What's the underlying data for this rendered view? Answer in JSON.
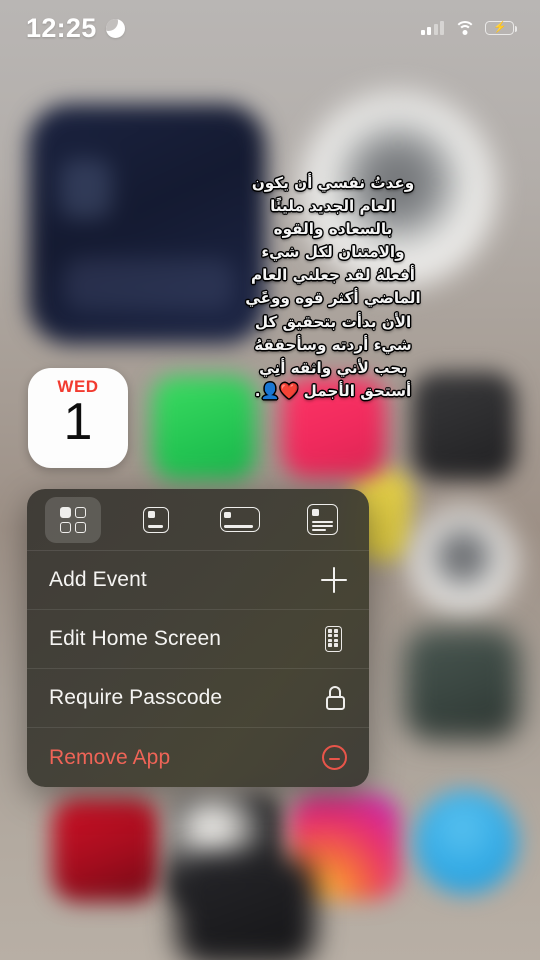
{
  "status_bar": {
    "time": "12:25",
    "dnd_icon": "moon-icon",
    "signal_icon": "cellular-signal-icon",
    "wifi_icon": "wifi-icon",
    "battery_icon": "battery-charging-icon"
  },
  "calendar_icon": {
    "weekday": "WED",
    "day": "1"
  },
  "overlay_text": {
    "lines": [
      "وعدتُ نفسي أن يكون",
      "العام الجديد مليئًا",
      "بالسعاده والقوه",
      "والامتنان لكل شيء",
      "أفعلهُ لقد جعلني العام",
      "الماضي أكثر قوه ووعًي",
      "الأن بدأت بتحقيق كل",
      "شيء أردته وسأحققهُ",
      "بحب لأني واثقه أنِي",
      "أستحق الأجمل ❤️👤."
    ]
  },
  "context_menu": {
    "size_options": [
      {
        "name": "app-grid",
        "label": "App Grid",
        "selected": true
      },
      {
        "name": "small-widget",
        "label": "Small Widget",
        "selected": false
      },
      {
        "name": "medium-widget",
        "label": "Medium Widget",
        "selected": false
      },
      {
        "name": "large-widget",
        "label": "Large Widget",
        "selected": false
      }
    ],
    "items": [
      {
        "label": "Add Event",
        "icon": "plus-icon",
        "destructive": false
      },
      {
        "label": "Edit Home Screen",
        "icon": "home-screen-icon",
        "destructive": false
      },
      {
        "label": "Require Passcode",
        "icon": "lock-icon",
        "destructive": false
      },
      {
        "label": "Remove App",
        "icon": "minus-circle-icon",
        "destructive": true
      }
    ]
  },
  "colors": {
    "menu_background": "#3a3732",
    "destructive": "#ef6457",
    "calendar_weekday": "#f23b30",
    "battery_green": "#34c759"
  }
}
